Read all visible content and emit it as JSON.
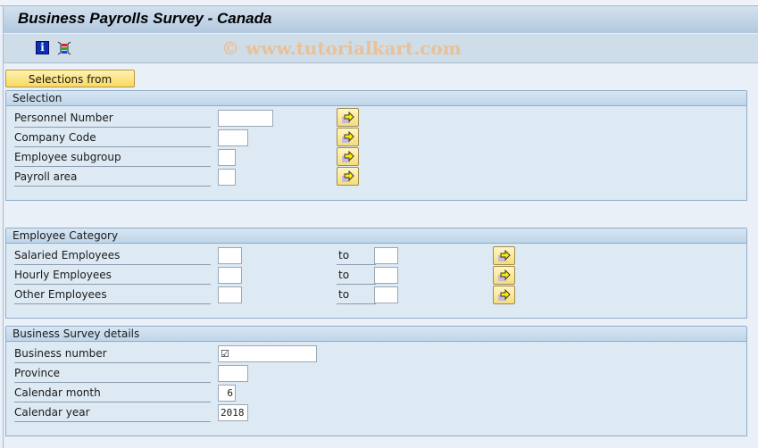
{
  "window": {
    "title": "Business Payrolls Survey - Canada",
    "watermark": "© www.tutorialkart.com"
  },
  "toolbar": {
    "icons": [
      "info-icon",
      "layout-icon"
    ],
    "info_glyph": "i"
  },
  "selections_button": {
    "label": "Selections from"
  },
  "groups": {
    "selection": {
      "title": "Selection",
      "rows": [
        {
          "label": "Personnel Number",
          "value": ""
        },
        {
          "label": "Company Code",
          "value": ""
        },
        {
          "label": "Employee subgroup",
          "value": ""
        },
        {
          "label": "Payroll area",
          "value": ""
        }
      ]
    },
    "employee_category": {
      "title": "Employee Category",
      "to_label": "to",
      "rows": [
        {
          "label": "Salaried Employees",
          "from": "",
          "to": ""
        },
        {
          "label": "Hourly Employees",
          "from": "",
          "to": ""
        },
        {
          "label": "Other Employees",
          "from": "",
          "to": ""
        }
      ]
    },
    "survey_details": {
      "title": "Business Survey details",
      "rows": [
        {
          "label": "Business number",
          "value": "☑"
        },
        {
          "label": "Province",
          "value": ""
        },
        {
          "label": "Calendar month",
          "value": "6"
        },
        {
          "label": "Calendar year",
          "value": "2018"
        }
      ]
    }
  },
  "colors": {
    "title_bar": "#b2c8df",
    "group_bg": "#dde9f3",
    "button_yellow": "#f9d95f",
    "watermark": "#eebd8e"
  }
}
